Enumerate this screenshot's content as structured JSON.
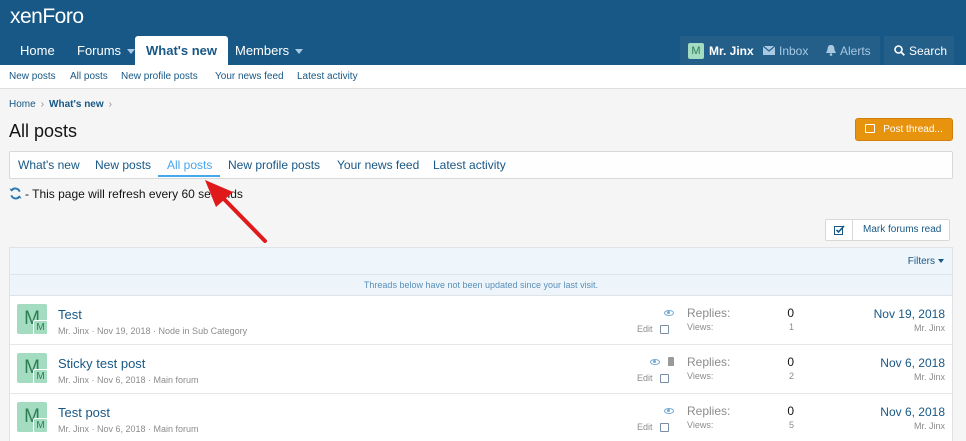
{
  "logo": "xenForo",
  "nav": {
    "tabs": [
      {
        "label": "Home"
      },
      {
        "label": "Forums"
      },
      {
        "label": "What's new"
      },
      {
        "label": "Members"
      }
    ],
    "user": "Mr. Jinx",
    "user_avatar": "M",
    "inbox": "Inbox",
    "alerts": "Alerts",
    "search": "Search"
  },
  "subnav": [
    "New posts",
    "All posts",
    "New profile posts",
    "Your news feed",
    "Latest activity"
  ],
  "breadcrumb": {
    "home": "Home",
    "current": "What's new"
  },
  "page_title": "All posts",
  "post_thread_label": "Post thread...",
  "tabs": [
    "What's new",
    "New posts",
    "All posts",
    "New profile posts",
    "Your news feed",
    "Latest activity"
  ],
  "refresh_text": "- This page will refresh every 60 seconds",
  "mark_read_label": "Mark forums read",
  "filters_label": "Filters",
  "unread_note": "Threads below have not been updated since your last visit.",
  "labels": {
    "replies": "Replies:",
    "views": "Views:",
    "edit": "Edit"
  },
  "threads": [
    {
      "title": "Test",
      "meta": "Mr. Jinx · Nov 19, 2018 · Node in Sub Category",
      "replies": "0",
      "views": "1",
      "last_date": "Nov 19, 2018",
      "last_user": "Mr. Jinx",
      "avatar": "M",
      "pinned": false
    },
    {
      "title": "Sticky test post",
      "meta": "Mr. Jinx · Nov 6, 2018 · Main forum",
      "replies": "0",
      "views": "2",
      "last_date": "Nov 6, 2018",
      "last_user": "Mr. Jinx",
      "avatar": "M",
      "pinned": true
    },
    {
      "title": "Test post",
      "meta": "Mr. Jinx · Nov 6, 2018 · Main forum",
      "replies": "0",
      "views": "5",
      "last_date": "Nov 6, 2018",
      "last_user": "Mr. Jinx",
      "avatar": "M",
      "pinned": false
    }
  ],
  "colors": {
    "header": "#185886",
    "accent": "#47a7eb",
    "button": "#e8930e",
    "arrow": "#e0191b"
  }
}
